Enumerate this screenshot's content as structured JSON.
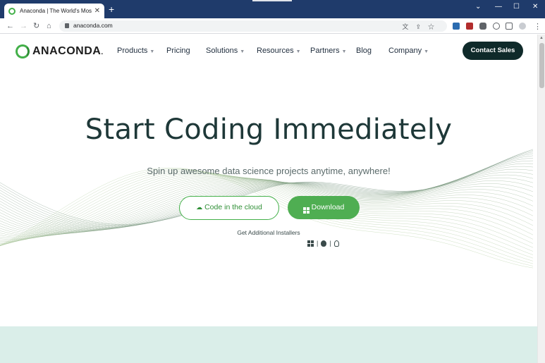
{
  "browser": {
    "tab_title": "Anaconda | The World's Most P",
    "tab_close": "✕",
    "new_tab": "+",
    "window_controls": [
      "⌄",
      "—",
      "☐",
      "✕"
    ],
    "nav": {
      "back": "←",
      "forward": "→",
      "reload": "↻",
      "home": "⌂"
    },
    "url": "anaconda.com",
    "menu": "⋮"
  },
  "site": {
    "logo_text": "ANACONDA",
    "logo_dot": ".",
    "nav_items": [
      {
        "label": "Products",
        "caret": true
      },
      {
        "label": "Pricing",
        "caret": false
      },
      {
        "label": "Solutions",
        "caret": true
      },
      {
        "label": "Resources",
        "caret": true
      },
      {
        "label": "Partners",
        "caret": true
      },
      {
        "label": "Blog",
        "caret": false
      },
      {
        "label": "Company",
        "caret": true
      }
    ],
    "caret_glyph": "▼",
    "contact_label": "Contact Sales"
  },
  "hero": {
    "title": "Start Coding Immediately",
    "subtitle": "Spin up awesome data science projects anytime, anywhere!",
    "cloud_button": "Code in the cloud",
    "cloud_icon": "☁",
    "download_button": "Download",
    "additional_installers": "Get Additional Installers",
    "separator": "|",
    "apple_glyph": "",
    "linux_glyph": "🐧"
  },
  "colors": {
    "accent_green": "#43b049",
    "download_green": "#4fae52",
    "contact_dark": "#0f2a2a",
    "title_color": "#1e3838",
    "band_color": "#daeee9",
    "tabstrip": "#1f3b6b"
  }
}
